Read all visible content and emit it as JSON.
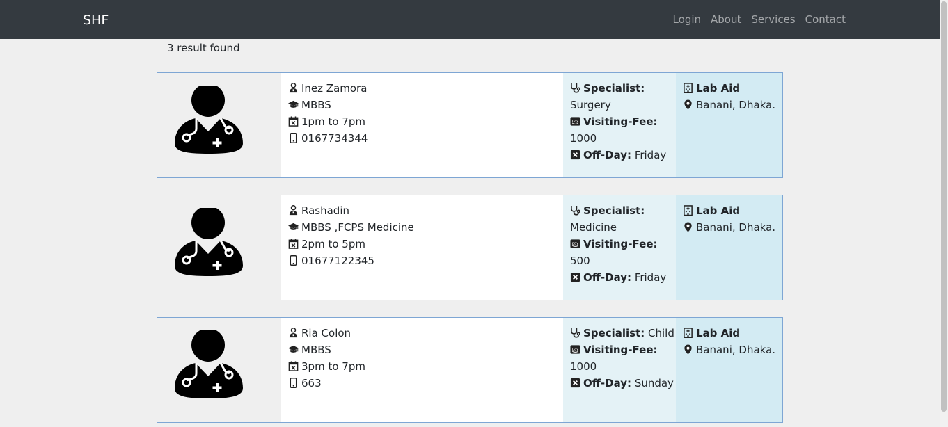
{
  "navbar": {
    "brand": "SHF",
    "links": [
      "Login",
      "About",
      "Services",
      "Contact"
    ]
  },
  "results": {
    "count_text": "3 result found"
  },
  "doctors": [
    {
      "name": "Inez Zamora",
      "degree": "MBBS",
      "time": "1pm to 7pm",
      "phone": "0167734344",
      "specialist_label": "Specialist:",
      "specialist": "Surgery",
      "fee_label": "Visiting-Fee:",
      "fee": "1000",
      "offday_label": "Off-Day:",
      "offday": "Friday",
      "hospital": "Lab Aid",
      "location": "Banani, Dhaka."
    },
    {
      "name": "Rashadin",
      "degree": "MBBS ,FCPS Medicine",
      "time": "2pm to 5pm",
      "phone": "01677122345",
      "specialist_label": "Specialist:",
      "specialist": "Medicine",
      "fee_label": "Visiting-Fee:",
      "fee": "500",
      "offday_label": "Off-Day:",
      "offday": "Friday",
      "hospital": "Lab Aid",
      "location": "Banani, Dhaka."
    },
    {
      "name": "Ria Colon",
      "degree": "MBBS",
      "time": "3pm to 7pm",
      "phone": "663",
      "specialist_label": "Specialist:",
      "specialist": "Child",
      "fee_label": "Visiting-Fee:",
      "fee": "1000",
      "offday_label": "Off-Day:",
      "offday": "Sunday",
      "hospital": "Lab Aid",
      "location": "Banani, Dhaka."
    }
  ],
  "icons": {
    "doctor": "user-doctor-icon",
    "degree": "graduation-cap-icon",
    "time": "calendar-xmark-icon",
    "phone": "mobile-phone-icon",
    "specialist": "stethoscope-icon",
    "fee": "amazon-pay-icon",
    "offday": "square-xmark-icon",
    "hospital": "hospital-building-icon",
    "location": "map-marker-icon"
  },
  "colors": {
    "navbar": "#343a40",
    "card_border": "#7ea6d4",
    "spec_bg": "#e4f2f6",
    "location_bg": "#d3ebf3"
  }
}
